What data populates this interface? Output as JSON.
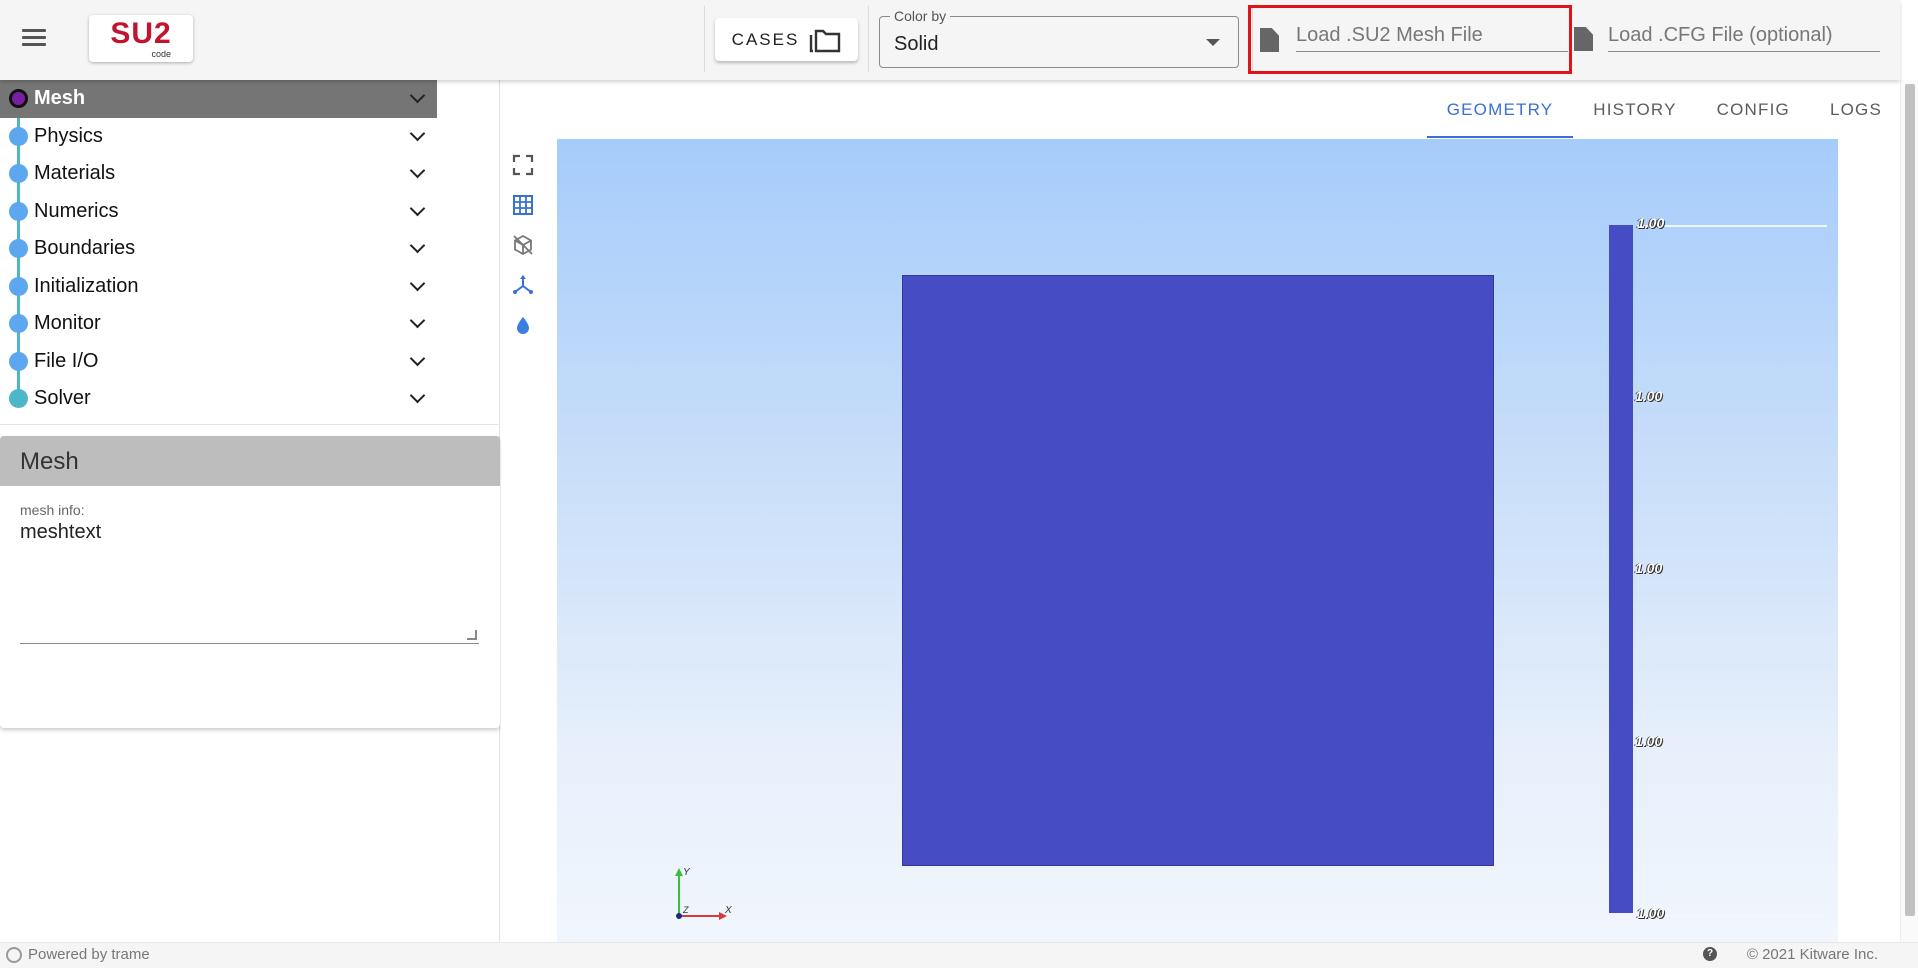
{
  "app": {
    "logo_text": "SU2",
    "logo_sub": "code"
  },
  "toolbar": {
    "cases_label": "CASES",
    "color_by_label": "Color by",
    "color_by_value": "Solid",
    "mesh_file_placeholder": "Load .SU2 Mesh File",
    "cfg_file_placeholder": "Load .CFG File (optional)"
  },
  "sidebar": {
    "steps": [
      {
        "label": "Mesh",
        "active": true
      },
      {
        "label": "Physics"
      },
      {
        "label": "Materials"
      },
      {
        "label": "Numerics"
      },
      {
        "label": "Boundaries"
      },
      {
        "label": "Initialization"
      },
      {
        "label": "Monitor"
      },
      {
        "label": "File I/O"
      },
      {
        "label": "Solver"
      }
    ],
    "panel": {
      "title": "Mesh",
      "field_label": "mesh info:",
      "field_value": "meshtext"
    }
  },
  "main": {
    "tabs": [
      {
        "label": "GEOMETRY",
        "active": true
      },
      {
        "label": "HISTORY"
      },
      {
        "label": "CONFIG"
      },
      {
        "label": "LOGS"
      }
    ],
    "view_tools": [
      "fullscreen-icon",
      "grid-icon",
      "cube-outline-icon",
      "axes-icon",
      "water-drop-icon"
    ],
    "colorbar_labels": [
      "1.00",
      "1.00",
      "1.00",
      "1.00",
      "1.00"
    ],
    "axes_labels": {
      "y": "Y",
      "x": "X",
      "z": "Z"
    }
  },
  "footer": {
    "powered_by": "Powered by trame",
    "help": "?",
    "copyright": "© 2021 Kitware Inc."
  },
  "colors": {
    "mesh_fill": "#464dc4",
    "highlight_box": "#e0121a",
    "accent": "#3a6fd6",
    "active_step": "#757575"
  }
}
